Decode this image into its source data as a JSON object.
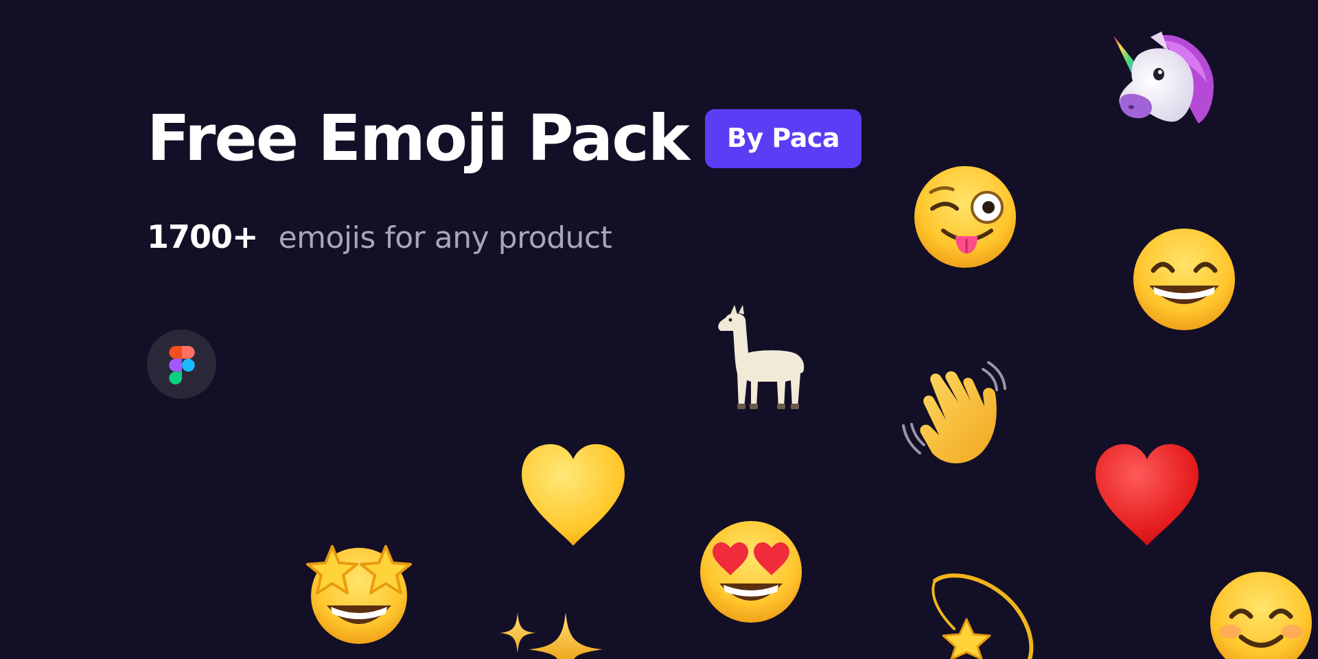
{
  "hero": {
    "title": "Free Emoji Pack",
    "badge_label": "By Paca"
  },
  "subtitle": {
    "count": "1700+",
    "text": "emojis for any product"
  },
  "figma_link": {
    "icon": "figma-icon",
    "colors": [
      "#f24e1e",
      "#ff7262",
      "#a259ff",
      "#1abcfe",
      "#0acf83"
    ]
  },
  "emojis": [
    {
      "name": "unicorn",
      "icon": "unicorn-icon"
    },
    {
      "name": "winking-face-with-tongue",
      "icon": "winking-face-with-tongue-icon"
    },
    {
      "name": "grinning-face-with-smiling-eyes",
      "icon": "grinning-face-with-smiling-eyes-icon"
    },
    {
      "name": "llama",
      "icon": "llama-icon"
    },
    {
      "name": "waving-hand",
      "icon": "waving-hand-icon"
    },
    {
      "name": "yellow-heart",
      "icon": "yellow-heart-icon"
    },
    {
      "name": "red-heart",
      "icon": "red-heart-icon"
    },
    {
      "name": "star-struck",
      "icon": "star-struck-icon"
    },
    {
      "name": "smiling-face-with-heart-eyes",
      "icon": "smiling-face-with-heart-eyes-icon"
    },
    {
      "name": "sparkles",
      "icon": "sparkles-icon"
    },
    {
      "name": "dizzy",
      "icon": "dizzy-icon"
    },
    {
      "name": "smiling-face-with-smiling-eyes",
      "icon": "smiling-face-with-smiling-eyes-icon"
    }
  ],
  "colors": {
    "background": "#130f26",
    "badge": "#5b3df5",
    "title": "#ffffff",
    "subtitle": "#a9a6b8",
    "figma_button": "#2a2838"
  }
}
